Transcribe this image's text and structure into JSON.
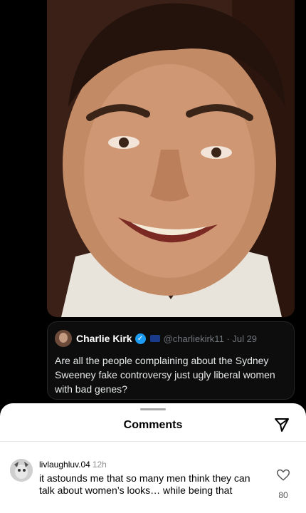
{
  "tweet": {
    "author": "Charlie Kirk",
    "handle": "@charliekirk11 · Jul 29",
    "text": "Are all the people complaining about the Sydney Sweeney fake controversy just ugly liberal women with bad genes?"
  },
  "comments_sheet": {
    "title": "Comments",
    "comments": [
      {
        "username": "livlaughluv.04",
        "time": "12h",
        "text": "it astounds me that so many men think they can talk about women’s looks… while being that",
        "likes": "80"
      }
    ]
  },
  "icons": {
    "send": "send-icon",
    "like": "heart-icon",
    "verified": "verified-badge-icon"
  },
  "colors": {
    "verified_blue": "#1d9bf0",
    "sheet_bg": "#ffffff",
    "dark_bg": "#000000"
  }
}
